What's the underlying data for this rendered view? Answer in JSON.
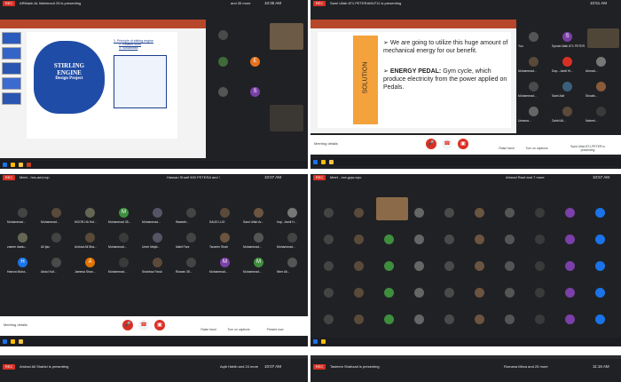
{
  "quadrants": [
    {
      "id": "top-left",
      "presenter_text": "ARMash AL Mahmood 25 is presenting",
      "right_text": "and 35 more",
      "clock": "10:35 AM",
      "slide": {
        "title_line1": "STIRLING",
        "title_line2": "ENGINE",
        "title_line3": "Design Project",
        "list": [
          "1. Principle of stirling engine",
          "2. Related work",
          "3. Solidworks"
        ]
      },
      "participants": [
        {
          "initial": "",
          "color": "#4a4a4a",
          "name": ""
        },
        {
          "initial": "",
          "color": "#6b5440",
          "name": ""
        },
        {
          "initial": "E",
          "color": "#e8711c",
          "name": ""
        },
        {
          "initial": "",
          "color": "#3f6b3a",
          "name": ""
        },
        {
          "initial": "S",
          "color": "#7b3fa8",
          "name": ""
        },
        {
          "initial": "",
          "color": "#3a3a3a",
          "name": ""
        }
      ]
    },
    {
      "id": "top-right",
      "presenter_text": "Sami Ullah 871.PETERAMLF11 is presenting",
      "right_text": "",
      "clock": "10:51 AM",
      "slide": {
        "side_label": "SOLUTION",
        "bullet1": "We are going to utilize this huge amount of mechanical energy for our benefit.",
        "bullet2_bold": "ENERGY PEDAL:",
        "bullet2_rest": " Gym cycle, which produce electricity from the power applied on Pedals."
      },
      "participants": [
        {
          "initial": "",
          "color": "#555",
          "name": "You"
        },
        {
          "initial": "S",
          "color": "#7b3fa8",
          "name": "Syeda Ullah 871 PETER"
        },
        {
          "initial": "",
          "color": "#46623b",
          "name": ""
        },
        {
          "initial": "",
          "color": "#5a4a3a",
          "name": "Muhammad..."
        },
        {
          "initial": "",
          "color": "#6b6b6b",
          "name": "Dup...Jamil Hi..."
        },
        {
          "initial": "",
          "color": "#777",
          "name": "Ahmad..."
        },
        {
          "initial": "",
          "color": "#4a4a4a",
          "name": "Muhammad..."
        },
        {
          "initial": "",
          "color": "#3b5f7a",
          "name": "Sami Asif"
        },
        {
          "initial": "",
          "color": "#8a5a3a",
          "name": "Shoaib..."
        },
        {
          "initial": "",
          "color": "#666",
          "name": "Umama..."
        },
        {
          "initial": "",
          "color": "#5b4a3a",
          "name": "Zahid Ali..."
        },
        {
          "initial": "",
          "color": "#3a3a3a",
          "name": "Nabeel..."
        }
      ],
      "bottom": {
        "meeting_details": "Meeting details",
        "raise_hand": "Raise hand",
        "turn_on_captions": "Turn on captions",
        "presenting": "Syed Ullah 871.PETER is presenting"
      }
    },
    {
      "id": "mid-left",
      "presenter_text": "Meet - hxs-aed-rvp",
      "right_text": "Hassan Sharif 500 PETERA and 7 more",
      "clock": "10:07 AM",
      "participants": [
        {
          "initial": "",
          "color": "#444",
          "name": "Muhammad..."
        },
        {
          "initial": "",
          "color": "#5a4a3a",
          "name": "Muhammad..."
        },
        {
          "initial": "",
          "color": "#665",
          "name": "NOOR-HA Huf..."
        },
        {
          "initial": "M",
          "color": "#3e8e3e",
          "name": "Muhammad 35..."
        },
        {
          "initial": "",
          "color": "#556",
          "name": "Muhammad..."
        },
        {
          "initial": "",
          "color": "#444",
          "name": "Waseeh..."
        },
        {
          "initial": "",
          "color": "#5b4a3a",
          "name": "SAUD LUO"
        },
        {
          "initial": "",
          "color": "#6b5440",
          "name": "Sami Ullah Ar..."
        },
        {
          "initial": "",
          "color": "#777",
          "name": "Inqi...Jamil H..."
        },
        {
          "initial": "",
          "color": "#665",
          "name": "zaeem dastu..."
        },
        {
          "initial": "",
          "color": "#444",
          "name": "Ali Ijaz"
        },
        {
          "initial": "",
          "color": "#5a4a3a",
          "name": "Arshad Ali Bha..."
        },
        {
          "initial": "",
          "color": "#3a3a3a",
          "name": "Muhammad..."
        },
        {
          "initial": "",
          "color": "#556",
          "name": "Umer Majid..."
        },
        {
          "initial": "",
          "color": "#444",
          "name": "Nabil Farz"
        },
        {
          "initial": "",
          "color": "#6b5440",
          "name": "Tanzeer Shah"
        },
        {
          "initial": "",
          "color": "#555",
          "name": "Muhammad..."
        },
        {
          "initial": "",
          "color": "#444",
          "name": "Mohammad..."
        },
        {
          "initial": "H",
          "color": "#1a73e8",
          "name": "Hamza Muha..."
        },
        {
          "initial": "",
          "color": "#4a4a4a",
          "name": "Abdul Kaf..."
        },
        {
          "initial": "A",
          "color": "#e37400",
          "name": "Jamesa Shan..."
        },
        {
          "initial": "",
          "color": "#3a3a3a",
          "name": "Muhammad..."
        },
        {
          "initial": "",
          "color": "#5b4a3a",
          "name": "Shahbaz Faruk"
        },
        {
          "initial": "",
          "color": "#444",
          "name": "Rizwan 35..."
        },
        {
          "initial": "M",
          "color": "#7b3fa8",
          "name": "Muhammad..."
        },
        {
          "initial": "M",
          "color": "#3e8e3e",
          "name": "Muhammad..."
        },
        {
          "initial": "",
          "color": "#555",
          "name": "Nimr Ali..."
        }
      ],
      "bottom": {
        "meeting_details": "Meeting details",
        "raise_hand": "Raise hand",
        "turn_on_captions": "Turn on captions",
        "present_now": "Present now"
      }
    },
    {
      "id": "mid-right",
      "presenter_text": "Meet - xxe-gqw-epu",
      "right_text": "Ahmad Rauf and 7 more",
      "clock": "10:57 AM",
      "participants": []
    },
    {
      "id": "bottom-left",
      "presenter_text": "Arshad Ali Shahid is presenting",
      "right_text": "Aqib Habib and 24 more",
      "clock": "10:07 AM"
    },
    {
      "id": "bottom-right",
      "presenter_text": "Tasleem Shahzad is presenting",
      "right_text": "Romana Mirza and 25 more",
      "clock": "11:16 AM"
    }
  ],
  "common": {
    "rec_label": "REC"
  }
}
